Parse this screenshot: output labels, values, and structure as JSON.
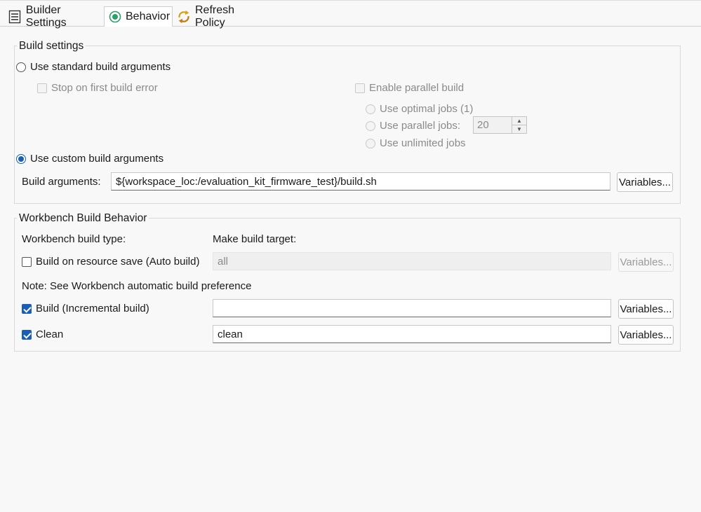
{
  "tabs": [
    {
      "label": "Builder Settings",
      "icon": "builder-settings-icon"
    },
    {
      "label": "Behavior",
      "icon": "behavior-icon"
    },
    {
      "label": "Refresh Policy",
      "icon": "refresh-policy-icon"
    }
  ],
  "active_tab": "Behavior",
  "build_settings": {
    "title": "Build settings",
    "use_standard_label": "Use standard build arguments",
    "stop_on_first_error_label": "Stop on first build error",
    "enable_parallel_label": "Enable parallel build",
    "use_optimal_jobs_label": "Use optimal jobs (1)",
    "use_parallel_jobs_label": "Use parallel jobs:",
    "parallel_jobs_value": "20",
    "use_unlimited_jobs_label": "Use unlimited jobs",
    "use_custom_label": "Use custom build arguments",
    "build_arguments_label": "Build arguments:",
    "build_arguments_value": "${workspace_loc:/evaluation_kit_firmware_test}/build.sh",
    "variables_label": "Variables..."
  },
  "workbench": {
    "title": "Workbench Build Behavior",
    "build_type_label": "Workbench build type:",
    "make_target_label": "Make build target:",
    "auto_build_label": "Build on resource save (Auto build)",
    "auto_build_value": "all",
    "note": "Note: See Workbench automatic build preference",
    "incremental_label": "Build (Incremental build)",
    "incremental_value": "",
    "clean_label": "Clean",
    "clean_value": "clean",
    "variables_label": "Variables..."
  },
  "colors": {
    "accent": "#1a5fb4",
    "behavior_icon": "#2e9e6a",
    "refresh_icon": "#d9a21b"
  }
}
